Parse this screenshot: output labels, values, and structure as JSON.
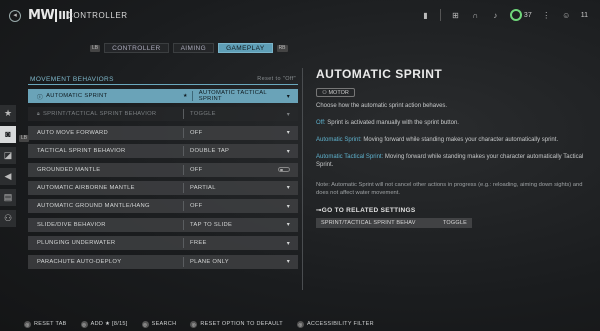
{
  "header": {
    "logo_main": "MW",
    "logo_roman": "III",
    "title": "CONTROLLER",
    "level": "37",
    "friends_count": "11"
  },
  "tabs": [
    {
      "label": "CONTROLLER",
      "active": false
    },
    {
      "label": "AIMING",
      "active": false
    },
    {
      "label": "GAMEPLAY",
      "active": true
    }
  ],
  "keys": {
    "lb_left": "LB",
    "rb_right": "RB",
    "lb_rail": "LB"
  },
  "section": {
    "title": "MOVEMENT BEHAVIORS",
    "reset_hint": "Reset to \"Off\""
  },
  "settings": [
    {
      "label": "AUTOMATIC SPRINT",
      "value": "AUTOMATIC TACTICAL SPRINT",
      "state": "selected"
    },
    {
      "label": "SPRINT/TACTICAL SPRINT BEHAVIOR",
      "value": "TOGGLE",
      "state": "disabled"
    },
    {
      "label": "AUTO MOVE FORWARD",
      "value": "OFF",
      "state": "normal"
    },
    {
      "label": "TACTICAL SPRINT BEHAVIOR",
      "value": "DOUBLE TAP",
      "state": "normal"
    },
    {
      "label": "GROUNDED MANTLE",
      "value": "OFF",
      "state": "toggle"
    },
    {
      "label": "AUTOMATIC AIRBORNE MANTLE",
      "value": "PARTIAL",
      "state": "normal"
    },
    {
      "label": "AUTOMATIC GROUND MANTLE/HANG",
      "value": "OFF",
      "state": "normal"
    },
    {
      "label": "SLIDE/DIVE BEHAVIOR",
      "value": "TAP TO SLIDE",
      "state": "normal"
    },
    {
      "label": "PLUNGING UNDERWATER",
      "value": "FREE",
      "state": "normal"
    },
    {
      "label": "PARACHUTE AUTO-DEPLOY",
      "value": "PLANE ONLY",
      "state": "normal"
    }
  ],
  "detail": {
    "title": "AUTOMATIC SPRINT",
    "tag": "MOTOR",
    "intro": "Choose how the automatic sprint action behaves.",
    "opt_off_name": "Off:",
    "opt_off_text": " Sprint is activated manually with the sprint button.",
    "opt_auto_name": "Automatic Sprint:",
    "opt_auto_text": " Moving forward while standing makes your character automatically sprint.",
    "opt_tac_name": "Automatic Tactical Sprint:",
    "opt_tac_text": " Moving forward while standing makes your character automatically Tactical Sprint.",
    "note": "Note: Automatic Sprint will not cancel other actions in progress (e.g.: reloading, aiming down sights) and does not affect water movement.",
    "related_title": "GO TO RELATED SETTINGS",
    "related_label": "SPRINT/TACTICAL SPRINT BEHAV",
    "related_value": "TOGGLE"
  },
  "footer": {
    "reset_tab": "RESET TAB",
    "add": "ADD ★ [8/15]",
    "search": "SEARCH",
    "reset_option": "RESET OPTION TO DEFAULT",
    "accessibility": "ACCESSIBILITY FILTER"
  },
  "colors": {
    "accent": "#6aa3b8",
    "link": "#5fb3cf",
    "level_ring": "#6fd67a"
  }
}
